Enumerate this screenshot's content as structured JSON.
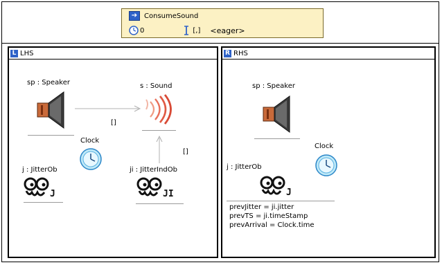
{
  "rule": {
    "name": "ConsumeSound",
    "priority": "0",
    "interval": "[,]",
    "mode": "<eager>"
  },
  "lhs": {
    "title": "LHS",
    "nodes": {
      "speaker": "sp : Speaker",
      "sound": "s : Sound",
      "clock": "Clock",
      "jitter": "j : JitterOb",
      "jitter_ind": "ji : JitterIndOb"
    },
    "edges": [
      "[]",
      "[]"
    ]
  },
  "rhs": {
    "title": "RHS",
    "nodes": {
      "speaker": "sp : Speaker",
      "clock": "Clock",
      "jitter": "j : JitterOb"
    },
    "attributes": [
      "prevJitter = ji.jitter",
      "prevTS = ji.timeStamp",
      "prevArrival = Clock.time"
    ]
  },
  "icons": {
    "rule": "rule-arrow-icon",
    "priority": "clock-small-icon",
    "interval": "i-beam-icon",
    "lhs": "lhs-l-icon",
    "rhs": "rhs-r-icon",
    "speaker": "speaker-icon",
    "sound": "sound-waves-icon",
    "clock": "clock-icon",
    "jitter": "jitter-face-icon"
  },
  "colors": {
    "rule_bg": "#fcf1c4",
    "icon_blue": "#2e62c8",
    "wave_red": "#e8705a"
  }
}
